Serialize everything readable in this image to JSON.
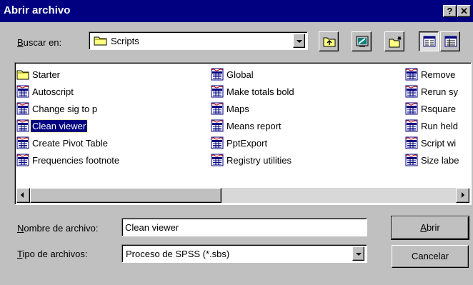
{
  "window": {
    "title": "Abrir archivo",
    "help_label": "?",
    "close_label": "✕"
  },
  "location": {
    "label_first": "B",
    "label_rest": "uscar en:",
    "folder": "Scripts",
    "folder_icon": "folder-icon"
  },
  "toolbar": {
    "buttons": [
      {
        "name": "up-one-level-button",
        "icon": "folder-up-icon"
      },
      {
        "name": "desktop-button",
        "icon": "desktop-icon"
      },
      {
        "name": "new-folder-button",
        "icon": "new-folder-icon"
      },
      {
        "name": "list-view-button",
        "icon": "list-view-icon",
        "pressed": true
      },
      {
        "name": "details-view-button",
        "icon": "details-view-icon"
      }
    ]
  },
  "files": {
    "col1": [
      "Starter",
      "Autoscript",
      "Change sig to p",
      "Clean viewer",
      "Create Pivot Table",
      "Frequencies footnote"
    ],
    "col2": [
      "Global",
      "Make totals bold",
      "Maps",
      "Means report",
      "PptExport",
      "Registry utilities"
    ],
    "col3": [
      "Remove",
      "Rerun sy",
      "Rsquare",
      "Run held",
      "Script wi",
      "Size labe"
    ],
    "selected": "Clean viewer",
    "folder_items": [
      "Starter"
    ]
  },
  "filename": {
    "label_first": "N",
    "label_rest": "ombre de archivo:",
    "value": "Clean viewer"
  },
  "filetype": {
    "label_first": "T",
    "label_rest": "ipo de archivos:",
    "value": "Proceso de SPSS (*.sbs)"
  },
  "buttons": {
    "open_first": "A",
    "open_rest": "brir",
    "cancel": "Cancelar"
  },
  "colors": {
    "title_bar": "#000080",
    "selection": "#000080",
    "face": "#c0c0c0"
  }
}
